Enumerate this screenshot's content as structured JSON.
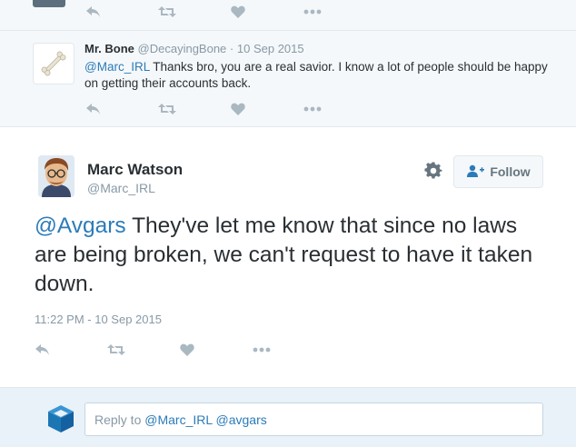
{
  "reply": {
    "author_name": "Mr. Bone",
    "author_handle": "@DecayingBone",
    "separator": "·",
    "date": "10 Sep 2015",
    "mention": "@Marc_IRL",
    "text": "Thanks bro, you are a real savior. I know a lot of people should be happy on getting their accounts back."
  },
  "main_tweet": {
    "author_name": "Marc Watson",
    "author_handle": "@Marc_IRL",
    "follow_label": "Follow",
    "mention": "@Avgars",
    "text": "They've let me know that since no laws are being broken, we can't request to have it taken down.",
    "timestamp": "11:22 PM - 10 Sep 2015"
  },
  "composer": {
    "placeholder_prefix": "Reply to",
    "mentions": "@Marc_IRL @avgars"
  },
  "icons": {
    "reply": "reply-icon",
    "retweet": "retweet-icon",
    "like": "heart-icon",
    "more": "more-icon",
    "gear": "gear-icon",
    "follow": "follow-user-icon",
    "composer": "cube-icon"
  },
  "colors": {
    "link": "#2b7bb9",
    "gray_text": "#8899a6",
    "action_icon": "#aab8c2",
    "composer_bg": "#e8f2f8",
    "tweet_bg": "#f5f8fa",
    "cube_blue": "#1d76b4"
  }
}
